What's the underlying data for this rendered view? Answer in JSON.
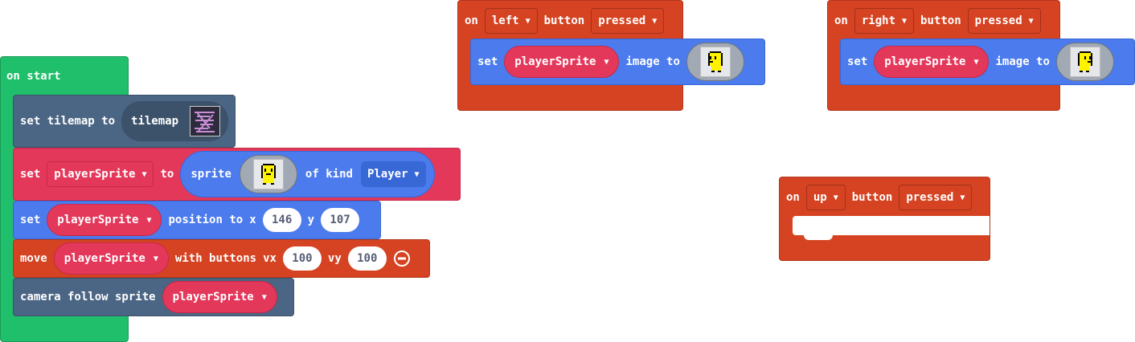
{
  "colors": {
    "events_green": "#20bf6b",
    "scene_slate": "#4b6584",
    "sprites_red": "#e4385b",
    "sprites_dark": "#c7294a",
    "set_blue": "#4b7bec",
    "controller_orange": "#d54322",
    "kind_blue": "#3867d6",
    "icon_yellow": "#fff200"
  },
  "on_start": {
    "label": "on start",
    "set_tilemap": {
      "prefix": "set tilemap to",
      "value": "tilemap",
      "thumbnail_icon": "tilemap-thumbnail-icon"
    },
    "set_sprite": {
      "prefix": "set",
      "variable": "playerSprite",
      "to": "to",
      "sprite_label": "sprite",
      "of_kind": "of kind",
      "kind": "Player",
      "image_icon": "yellow-character-icon"
    },
    "set_position": {
      "prefix": "set",
      "variable": "playerSprite",
      "position_to": "position to",
      "x_label": "x",
      "x": "146",
      "y_label": "y",
      "y": "107"
    },
    "move": {
      "prefix": "move",
      "variable": "playerSprite",
      "with_buttons": "with buttons",
      "vx_label": "vx",
      "vx": "100",
      "vy_label": "vy",
      "vy": "100",
      "remove_icon": "minus-circle-icon"
    },
    "camera": {
      "prefix": "camera follow sprite",
      "variable": "playerSprite"
    }
  },
  "on_left": {
    "on": "on",
    "button": "left",
    "button_label": "button",
    "event": "pressed",
    "set": {
      "prefix": "set",
      "variable": "playerSprite",
      "image_to": "image to",
      "image_icon": "yellow-character-left-icon"
    }
  },
  "on_right": {
    "on": "on",
    "button": "right",
    "button_label": "button",
    "event": "pressed",
    "set": {
      "prefix": "set",
      "variable": "playerSprite",
      "image_to": "image to",
      "image_icon": "yellow-character-right-icon"
    }
  },
  "on_up": {
    "on": "on",
    "button": "up",
    "button_label": "button",
    "event": "pressed"
  }
}
